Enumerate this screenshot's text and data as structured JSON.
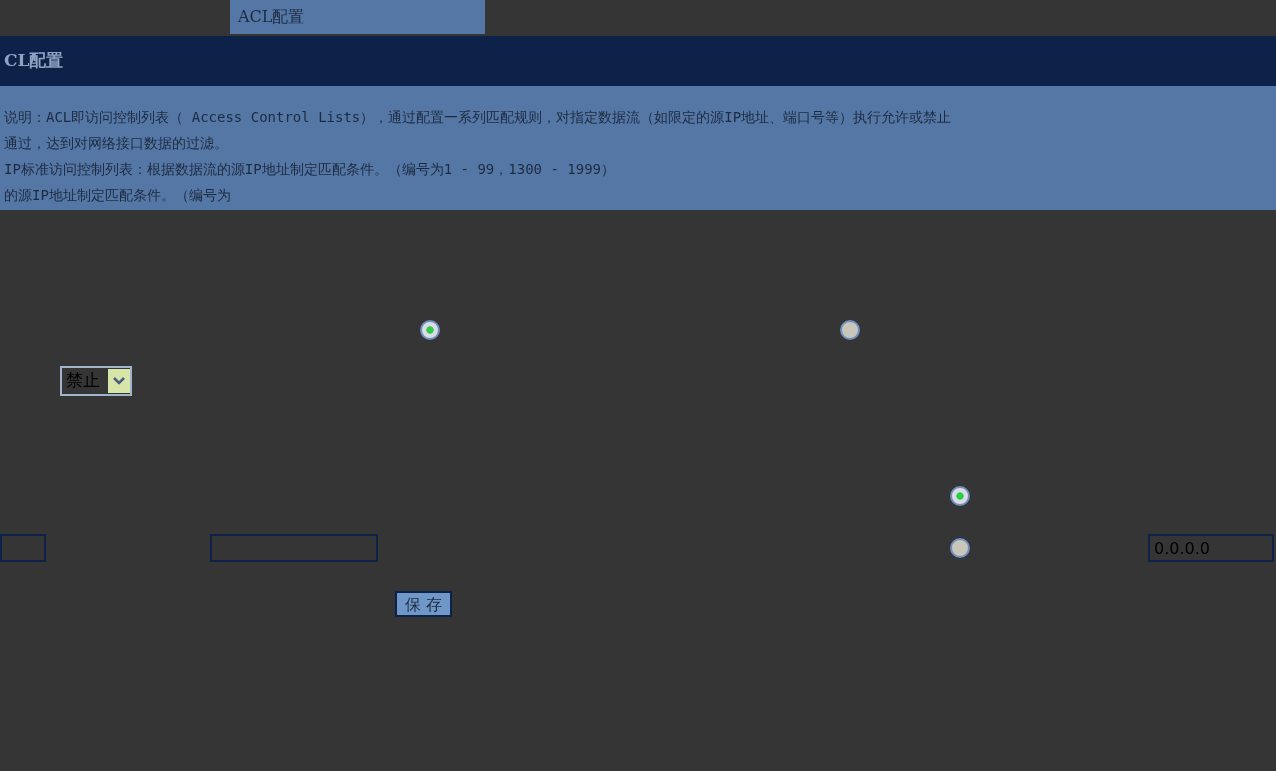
{
  "tabs": [
    {
      "label": "ACL配置",
      "selected": true
    }
  ],
  "header": {
    "title": "CL配置"
  },
  "description": [
    "说明：ACL即访问控制列表（ Access Control Lists），通过配置一系列匹配规则，对指定数据流（如限定的源IP地址、端口号等）执行允许或禁止",
    "通过，达到对网络接口数据的过滤。",
    "IP标准访问控制列表：根据数据流的源IP地址制定匹配条件。（编号为1 - 99，1300 - 1999）",
    "的源IP地址制定匹配条件。（编号为"
  ],
  "type_radios": [
    {
      "selected": true
    },
    {
      "selected": false
    }
  ],
  "action_select": {
    "value": "禁止"
  },
  "source_radios": [
    {
      "selected": true
    },
    {
      "selected": false
    }
  ],
  "ip_field": {
    "value": "0.0.0.0"
  },
  "save_button": "保 存"
}
